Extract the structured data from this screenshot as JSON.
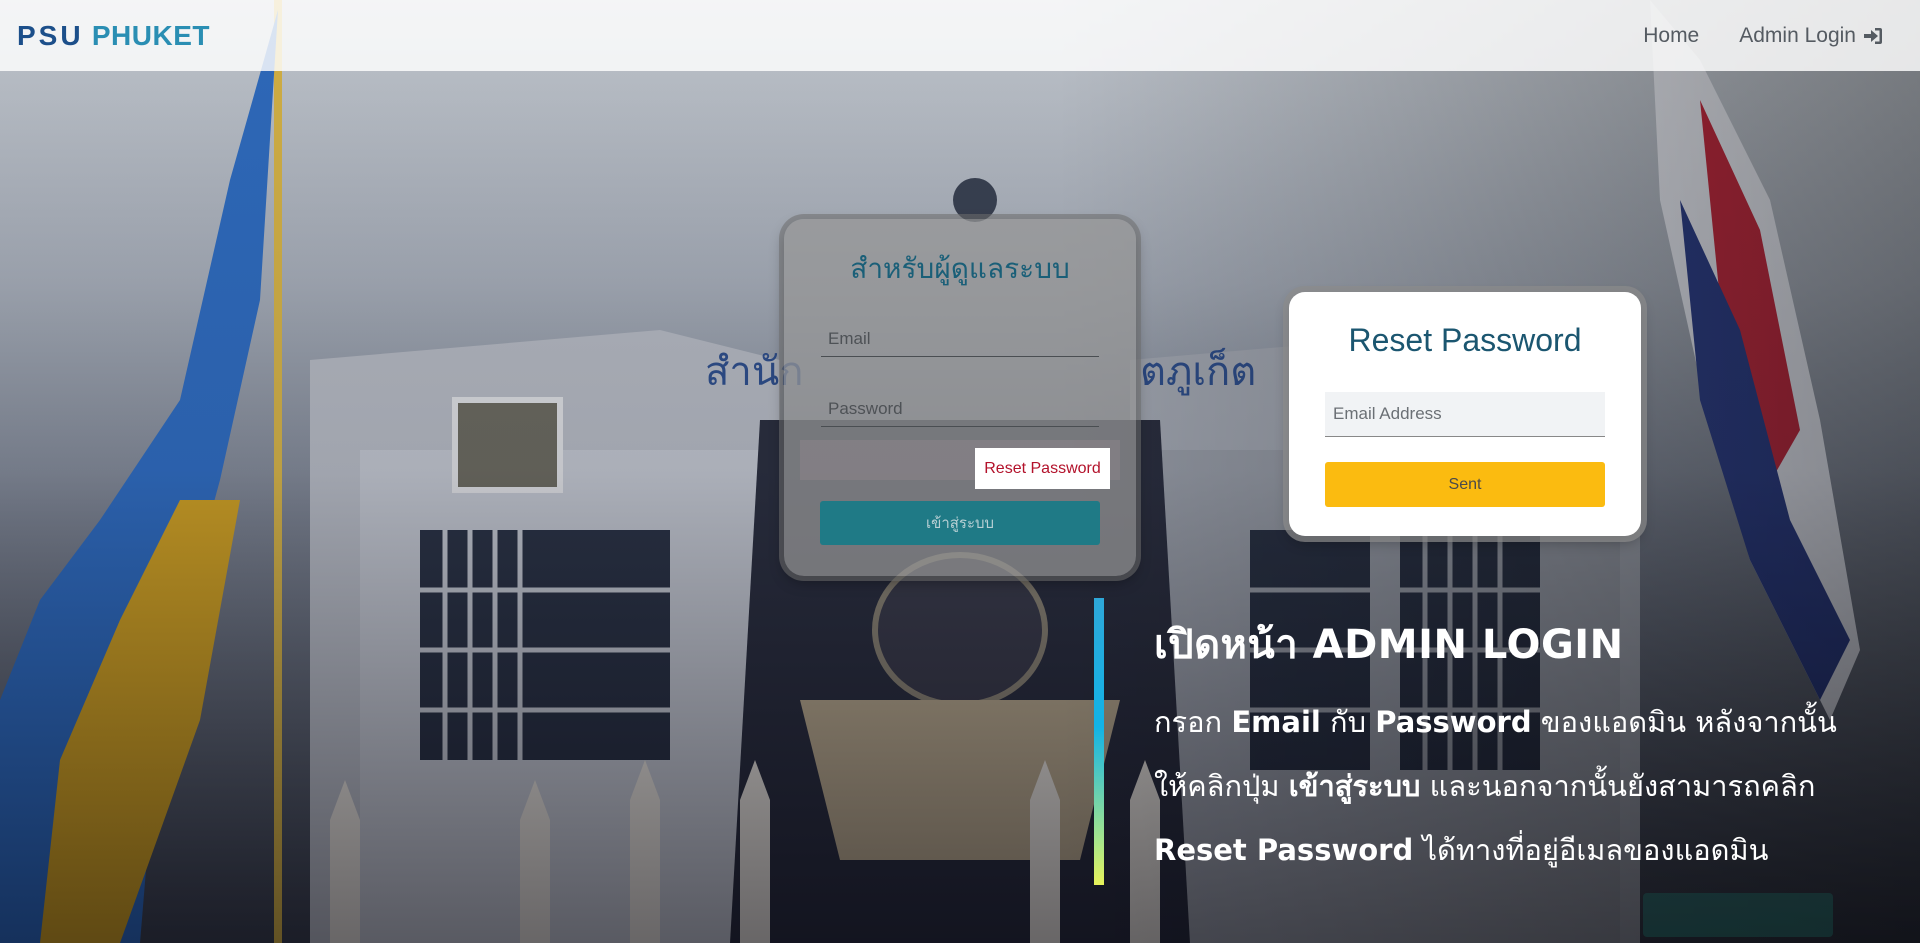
{
  "navbar": {
    "brand_part1": "PSU",
    "brand_part2": "PHUKET",
    "home_label": "Home",
    "admin_login_label": "Admin Login"
  },
  "login_card": {
    "title": "สำหรับผู้ดูแลระบบ",
    "email_placeholder": "Email",
    "password_placeholder": "Password",
    "reset_link_label": "Reset Password",
    "submit_label": "เข้าสู่ระบบ"
  },
  "reset_card": {
    "title": "Reset Password",
    "email_placeholder": "Email Address",
    "submit_label": "Sent"
  },
  "description": {
    "heading": "เปิดหน้า ADMIN LOGIN",
    "l1_a": "กรอก ",
    "l1_b": "Email",
    "l1_c": " กับ ",
    "l1_d": "Password",
    "l1_e": " ของแอดมิน หลังจากนั้น",
    "l2_a": "ให้คลิกปุ่ม ",
    "l2_b": "เข้าสู่ระบบ",
    "l2_c": " และนอกจากนั้นยังสามารถคลิก",
    "l3_a": "Reset Password",
    "l3_b": " ได้ทางที่อยู่อีเมลของแอดมิน"
  },
  "colors": {
    "brand_dark": "#1c4f8a",
    "brand_light": "#2a8eb3",
    "login_button": "#1f7a86",
    "sent_button": "#fbbb10",
    "reset_link_text": "#b3122b"
  },
  "icons": {
    "admin_login": "sign-in-icon"
  }
}
